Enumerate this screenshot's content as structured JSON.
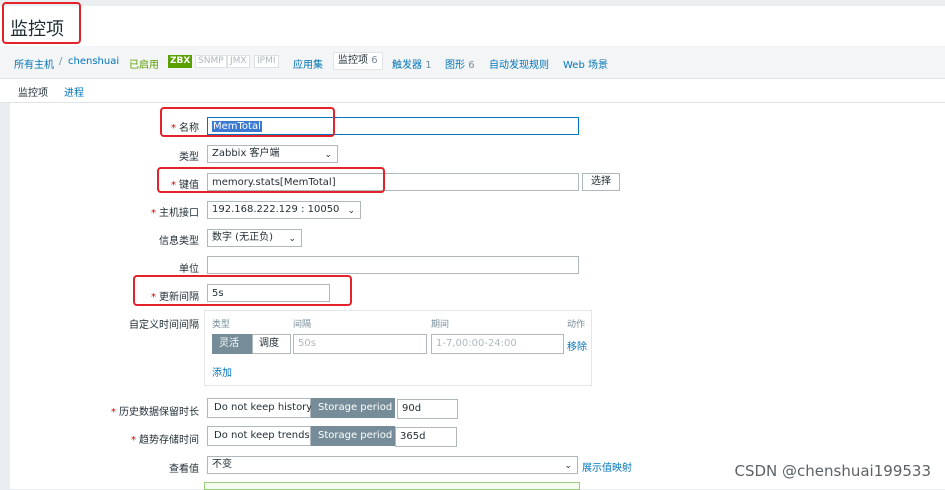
{
  "page_title": "监控项",
  "nav": {
    "all_hosts": "所有主机",
    "separator": "/",
    "host": "chenshuai",
    "status": "已启用",
    "zbx": "ZBX",
    "snmp": "SNMP",
    "jmx": "JMX",
    "ipmi": "IPMI",
    "applications": "应用集",
    "items": "监控项",
    "items_count": "6",
    "triggers": "触发器",
    "triggers_count": "1",
    "graphs": "图形",
    "graphs_count": "6",
    "discovery": "自动发现规则",
    "web": "Web 场景"
  },
  "tabs": {
    "item": "监控项",
    "process": "进程"
  },
  "form": {
    "name_label": "名称",
    "name_value": "MemTotal",
    "type_label": "类型",
    "type_value": "Zabbix 客户端",
    "key_label": "键值",
    "key_value": "memory.stats[MemTotal]",
    "select_button": "选择",
    "interface_label": "主机接口",
    "interface_value": "192.168.222.129 : 10050",
    "info_type_label": "信息类型",
    "info_type_value": "数字 (无正负)",
    "units_label": "单位",
    "units_value": "",
    "interval_label": "更新间隔",
    "interval_value": "5s",
    "custom_label": "自定义时间间隔",
    "custom": {
      "col_type": "类型",
      "col_interval": "间隔",
      "col_period": "期间",
      "col_action": "动作",
      "flexible": "灵活",
      "scheduling": "调度",
      "interval_placeholder": "50s",
      "period_placeholder": "1-7,00:00-24:00",
      "remove": "移除",
      "add": "添加"
    },
    "history_label": "历史数据保留时长",
    "history_no_keep": "Do not keep history",
    "history_storage": "Storage period",
    "history_value": "90d",
    "trends_label": "趋势存储时间",
    "trends_no_keep": "Do not keep trends",
    "trends_storage": "Storage period",
    "trends_value": "365d",
    "show_value_label": "查看值",
    "show_value_value": "不变",
    "show_value_link": "展示值映射"
  },
  "watermark": "CSDN @chenshuai199533"
}
